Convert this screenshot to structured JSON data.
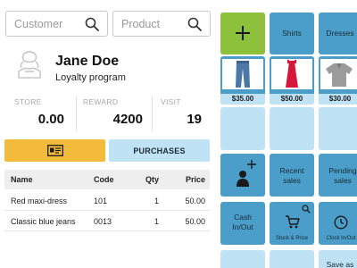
{
  "search": {
    "customer_placeholder": "Customer",
    "product_placeholder": "Product"
  },
  "customer": {
    "name": "Jane Doe",
    "program": "Loyalty program"
  },
  "stats": [
    {
      "label": "STORE",
      "value": "0.00"
    },
    {
      "label": "REWARD",
      "value": "4200"
    },
    {
      "label": "VISIT",
      "value": "19"
    }
  ],
  "actions": {
    "purchases_label": "PURCHASES"
  },
  "table": {
    "headers": [
      "Name",
      "Code",
      "Qty",
      "Price"
    ],
    "rows": [
      [
        "Red maxi-dress",
        "101",
        "1",
        "50.00"
      ],
      [
        "Classic blue jeans",
        "0013",
        "1",
        "50.00"
      ]
    ]
  },
  "grid": {
    "categories": [
      "Shirts",
      "Dresses"
    ],
    "products": [
      {
        "name": "blue jeans",
        "price": "$35.00"
      },
      {
        "name": "red dress",
        "price": "$50.00"
      },
      {
        "name": "grey polo shirt",
        "price": "$30.00"
      }
    ],
    "functions": {
      "recent_sales": "Recent sales",
      "pending_sales": "Pending sales",
      "cash_in_out": "Cash In/Out",
      "stock_price": "Stock & Price",
      "clock_in_out": "Clock In/Out",
      "save_as": "Save as"
    }
  },
  "colors": {
    "accent_blue": "#4a9ec9",
    "pale_blue": "#bfe3f5",
    "green": "#8dc03b",
    "yellow": "#f2bb3c"
  }
}
